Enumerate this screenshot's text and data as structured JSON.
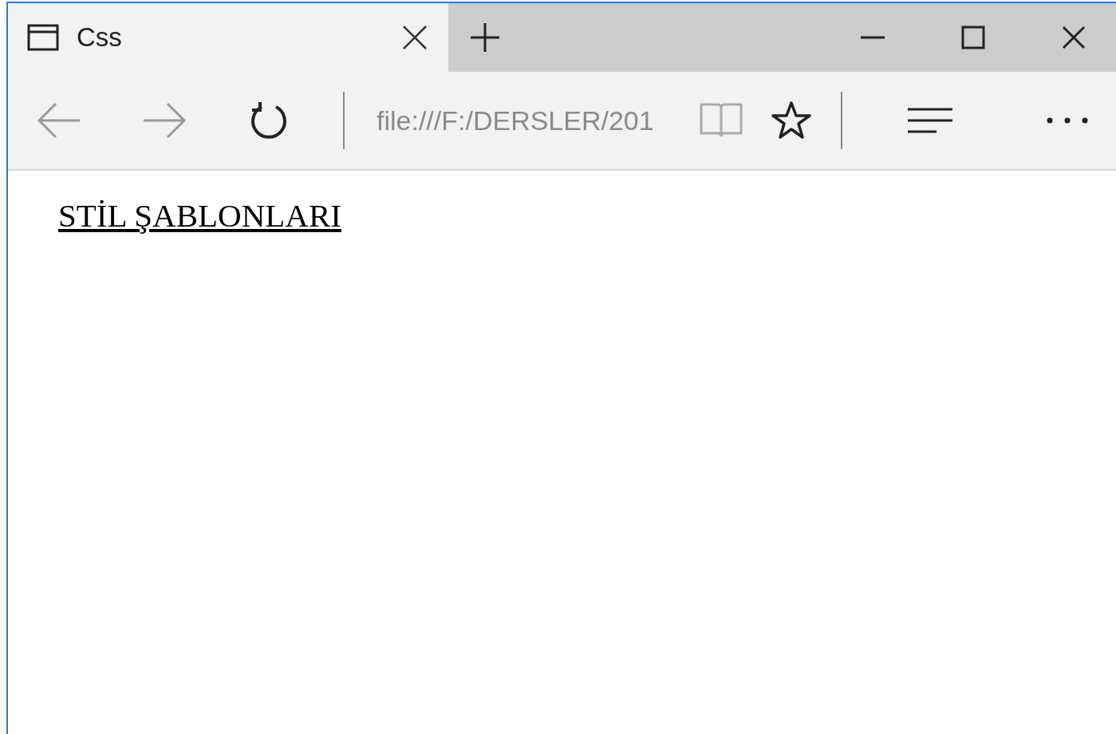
{
  "tab": {
    "title": "Css"
  },
  "navigation": [
    {
      "kind": "back",
      "disabled": true
    },
    {
      "kind": "forward",
      "disabled": true
    },
    {
      "kind": "refresh",
      "disabled": false
    }
  ],
  "address_bar": {
    "value": "file:///F:/DERSLER/201"
  },
  "page": {
    "heading": "STİL ŞABLONLARI"
  }
}
